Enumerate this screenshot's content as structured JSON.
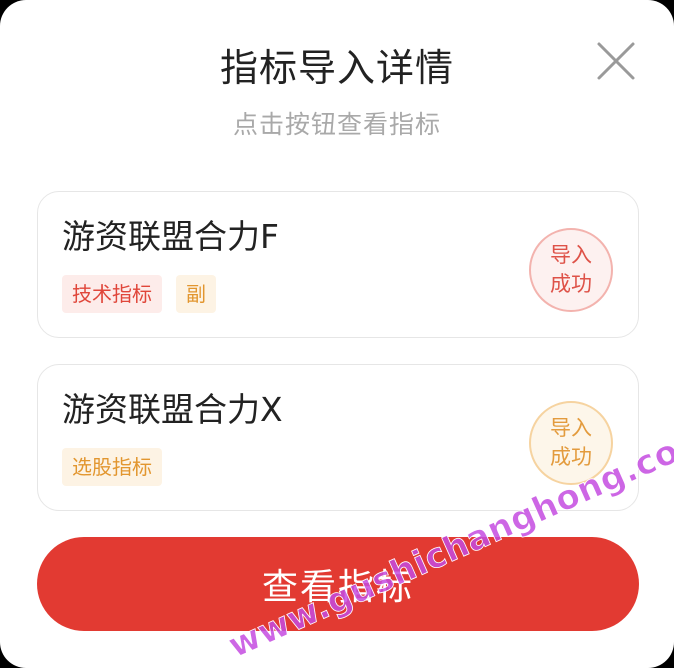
{
  "modal": {
    "title": "指标导入详情",
    "subtitle": "点击按钮查看指标"
  },
  "cards": [
    {
      "name": "游资联盟合力F",
      "tags": [
        "技术指标",
        "副"
      ],
      "stamp_line1": "导入",
      "stamp_line2": "成功"
    },
    {
      "name": "游资联盟合力X",
      "tags": [
        "选股指标"
      ],
      "stamp_line1": "导入",
      "stamp_line2": "成功"
    }
  ],
  "button": {
    "label": "查看指标"
  },
  "watermark": {
    "text": "www.gushichanghong.com"
  },
  "colors": {
    "primary": "#e23a32",
    "tag_red_text": "#e0463a",
    "tag_orange_text": "#e2962f",
    "watermark": "#c44be0"
  },
  "icons": {
    "close": "close-icon"
  }
}
